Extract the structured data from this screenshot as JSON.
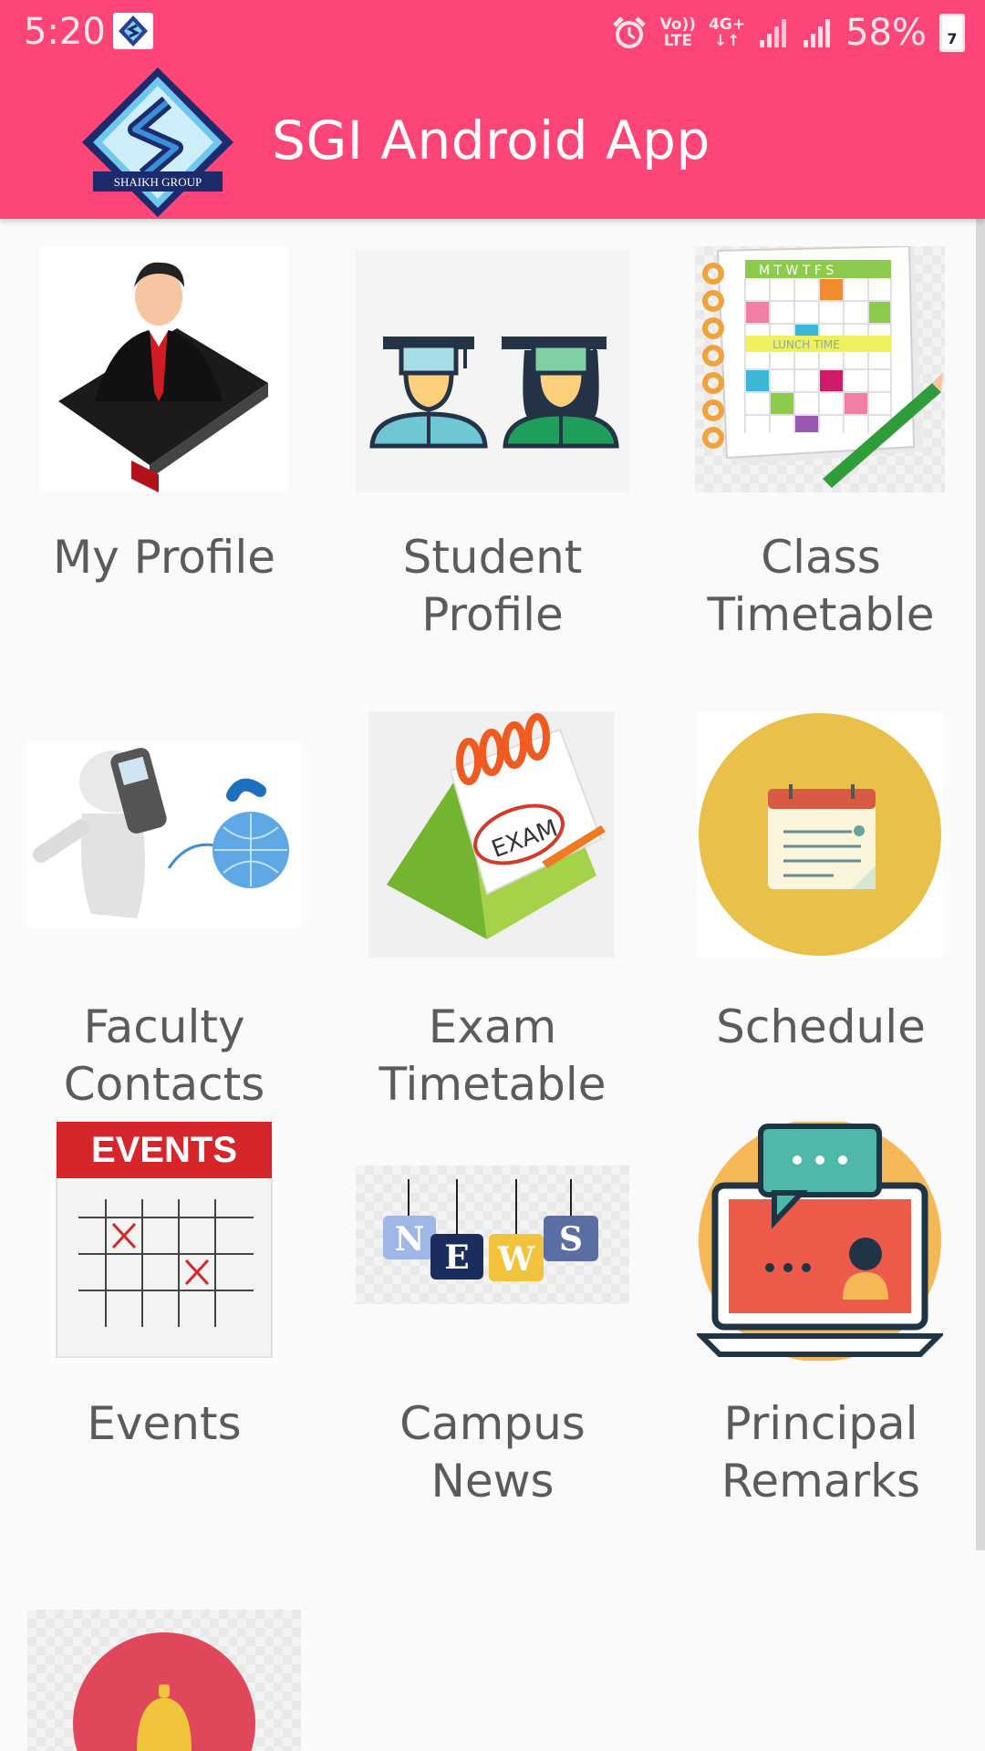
{
  "status_bar": {
    "time": "5:20",
    "volte": "Vo))",
    "lte": "LTE",
    "network": "4G+",
    "battery_percent": "58%",
    "battery_badge": "7",
    "icons": [
      "app-logo-icon",
      "alarm-icon",
      "signal-icon",
      "signal-icon",
      "battery-icon"
    ]
  },
  "app_bar": {
    "title": "SGI Android App",
    "logo_text": "SHAIKH GROUP",
    "background": "#fd4577"
  },
  "menu": {
    "items": [
      {
        "label_line1": "My Profile",
        "label_line2": "",
        "icon": "teacher-profile-icon"
      },
      {
        "label_line1": "Student",
        "label_line2": "Profile",
        "icon": "graduates-icon"
      },
      {
        "label_line1": "Class",
        "label_line2": "Timetable",
        "icon": "timetable-calendar-icon"
      },
      {
        "label_line1": "Faculty",
        "label_line2": "Contacts",
        "icon": "phone-contact-icon"
      },
      {
        "label_line1": "Exam",
        "label_line2": "Timetable",
        "icon": "exam-calendar-icon"
      },
      {
        "label_line1": "Schedule",
        "label_line2": "",
        "icon": "schedule-notepad-icon"
      },
      {
        "label_line1": "Events",
        "label_line2": "",
        "icon": "events-calendar-icon"
      },
      {
        "label_line1": "Campus",
        "label_line2": "News",
        "icon": "news-icon"
      },
      {
        "label_line1": "Principal",
        "label_line2": "Remarks",
        "icon": "laptop-chat-icon"
      },
      {
        "label_line1": "",
        "label_line2": "",
        "icon": "bell-icon"
      }
    ],
    "schedule_text": "LUNCH TIME",
    "timetable_days": [
      "M",
      "T",
      "W",
      "T",
      "F",
      "S"
    ],
    "exam_text": "EXAM",
    "events_text": "EVENTS",
    "news_letters": [
      "N",
      "E",
      "W",
      "S"
    ]
  }
}
